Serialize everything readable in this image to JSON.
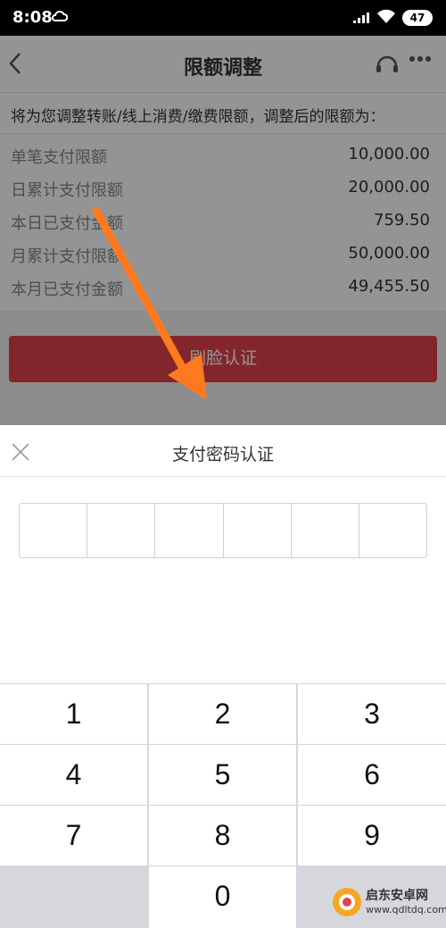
{
  "status": {
    "time": "8:08",
    "battery": "47"
  },
  "nav": {
    "title": "限额调整"
  },
  "notice": "将为您调整转账/线上消费/缴费限额，调整后的限额为：",
  "limits": [
    {
      "label": "单笔支付限额",
      "value": "10,000.00"
    },
    {
      "label": "日累计支付限额",
      "value": "20,000.00"
    },
    {
      "label": "本日已支付金额",
      "value": "759.50"
    },
    {
      "label": "月累计支付限额",
      "value": "50,000.00"
    },
    {
      "label": "本月已支付金额",
      "value": "49,455.50"
    }
  ],
  "face_button": "刷脸认证",
  "sheet": {
    "title": "支付密码认证"
  },
  "keypad": {
    "k1": "1",
    "k2": "2",
    "k3": "3",
    "k4": "4",
    "k5": "5",
    "k6": "6",
    "k7": "7",
    "k8": "8",
    "k9": "9",
    "k0": "0"
  },
  "watermark": {
    "name": "启东安卓网",
    "url": "www.qdltdq.com"
  },
  "colors": {
    "accent": "#e0434a",
    "arrow": "#ff7a1e",
    "keypad_bg": "#d5d7dc"
  }
}
